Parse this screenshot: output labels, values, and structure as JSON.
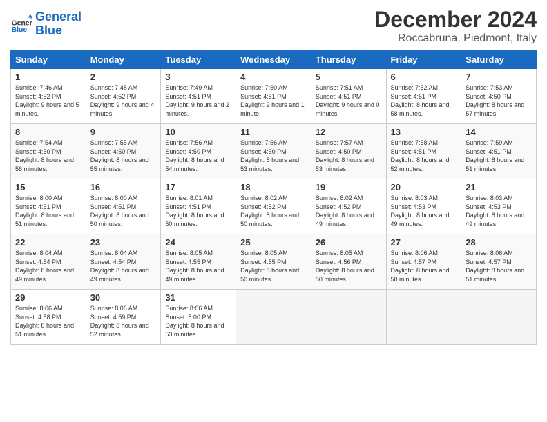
{
  "logo": {
    "text_general": "General",
    "text_blue": "Blue"
  },
  "title": "December 2024",
  "location": "Roccabruna, Piedmont, Italy",
  "headers": [
    "Sunday",
    "Monday",
    "Tuesday",
    "Wednesday",
    "Thursday",
    "Friday",
    "Saturday"
  ],
  "weeks": [
    [
      {
        "day": "1",
        "sunrise": "7:46 AM",
        "sunset": "4:52 PM",
        "daylight": "9 hours and 5 minutes."
      },
      {
        "day": "2",
        "sunrise": "7:48 AM",
        "sunset": "4:52 PM",
        "daylight": "9 hours and 4 minutes."
      },
      {
        "day": "3",
        "sunrise": "7:49 AM",
        "sunset": "4:51 PM",
        "daylight": "9 hours and 2 minutes."
      },
      {
        "day": "4",
        "sunrise": "7:50 AM",
        "sunset": "4:51 PM",
        "daylight": "9 hours and 1 minute."
      },
      {
        "day": "5",
        "sunrise": "7:51 AM",
        "sunset": "4:51 PM",
        "daylight": "9 hours and 0 minutes."
      },
      {
        "day": "6",
        "sunrise": "7:52 AM",
        "sunset": "4:51 PM",
        "daylight": "8 hours and 58 minutes."
      },
      {
        "day": "7",
        "sunrise": "7:53 AM",
        "sunset": "4:50 PM",
        "daylight": "8 hours and 57 minutes."
      }
    ],
    [
      {
        "day": "8",
        "sunrise": "7:54 AM",
        "sunset": "4:50 PM",
        "daylight": "8 hours and 56 minutes."
      },
      {
        "day": "9",
        "sunrise": "7:55 AM",
        "sunset": "4:50 PM",
        "daylight": "8 hours and 55 minutes."
      },
      {
        "day": "10",
        "sunrise": "7:56 AM",
        "sunset": "4:50 PM",
        "daylight": "8 hours and 54 minutes."
      },
      {
        "day": "11",
        "sunrise": "7:56 AM",
        "sunset": "4:50 PM",
        "daylight": "8 hours and 53 minutes."
      },
      {
        "day": "12",
        "sunrise": "7:57 AM",
        "sunset": "4:50 PM",
        "daylight": "8 hours and 53 minutes."
      },
      {
        "day": "13",
        "sunrise": "7:58 AM",
        "sunset": "4:51 PM",
        "daylight": "8 hours and 52 minutes."
      },
      {
        "day": "14",
        "sunrise": "7:59 AM",
        "sunset": "4:51 PM",
        "daylight": "8 hours and 51 minutes."
      }
    ],
    [
      {
        "day": "15",
        "sunrise": "8:00 AM",
        "sunset": "4:51 PM",
        "daylight": "8 hours and 51 minutes."
      },
      {
        "day": "16",
        "sunrise": "8:00 AM",
        "sunset": "4:51 PM",
        "daylight": "8 hours and 50 minutes."
      },
      {
        "day": "17",
        "sunrise": "8:01 AM",
        "sunset": "4:51 PM",
        "daylight": "8 hours and 50 minutes."
      },
      {
        "day": "18",
        "sunrise": "8:02 AM",
        "sunset": "4:52 PM",
        "daylight": "8 hours and 50 minutes."
      },
      {
        "day": "19",
        "sunrise": "8:02 AM",
        "sunset": "4:52 PM",
        "daylight": "8 hours and 49 minutes."
      },
      {
        "day": "20",
        "sunrise": "8:03 AM",
        "sunset": "4:53 PM",
        "daylight": "8 hours and 49 minutes."
      },
      {
        "day": "21",
        "sunrise": "8:03 AM",
        "sunset": "4:53 PM",
        "daylight": "8 hours and 49 minutes."
      }
    ],
    [
      {
        "day": "22",
        "sunrise": "8:04 AM",
        "sunset": "4:54 PM",
        "daylight": "8 hours and 49 minutes."
      },
      {
        "day": "23",
        "sunrise": "8:04 AM",
        "sunset": "4:54 PM",
        "daylight": "8 hours and 49 minutes."
      },
      {
        "day": "24",
        "sunrise": "8:05 AM",
        "sunset": "4:55 PM",
        "daylight": "8 hours and 49 minutes."
      },
      {
        "day": "25",
        "sunrise": "8:05 AM",
        "sunset": "4:55 PM",
        "daylight": "8 hours and 50 minutes."
      },
      {
        "day": "26",
        "sunrise": "8:05 AM",
        "sunset": "4:56 PM",
        "daylight": "8 hours and 50 minutes."
      },
      {
        "day": "27",
        "sunrise": "8:06 AM",
        "sunset": "4:57 PM",
        "daylight": "8 hours and 50 minutes."
      },
      {
        "day": "28",
        "sunrise": "8:06 AM",
        "sunset": "4:57 PM",
        "daylight": "8 hours and 51 minutes."
      }
    ],
    [
      {
        "day": "29",
        "sunrise": "8:06 AM",
        "sunset": "4:58 PM",
        "daylight": "8 hours and 51 minutes."
      },
      {
        "day": "30",
        "sunrise": "8:06 AM",
        "sunset": "4:59 PM",
        "daylight": "8 hours and 52 minutes."
      },
      {
        "day": "31",
        "sunrise": "8:06 AM",
        "sunset": "5:00 PM",
        "daylight": "8 hours and 53 minutes."
      },
      null,
      null,
      null,
      null
    ]
  ]
}
